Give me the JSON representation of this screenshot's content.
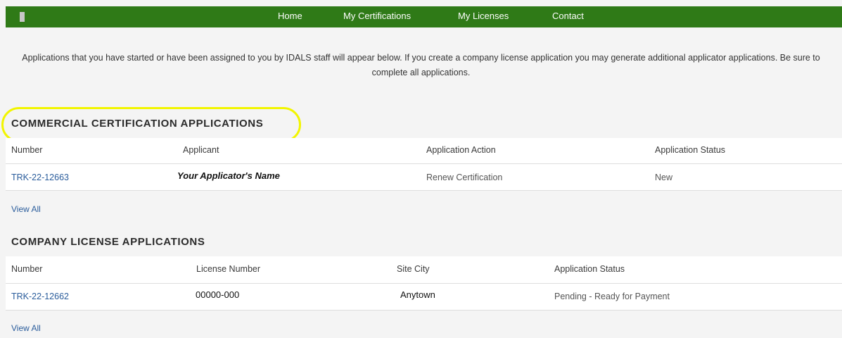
{
  "nav": {
    "items": [
      "Home",
      "My Certifications",
      "My Licenses",
      "Contact"
    ]
  },
  "intro": {
    "text": "Applications that you have started or have been assigned to you by IDALS staff will appear below.  If you create a company license application you may generate additional applicator applications.  Be sure to complete all applications."
  },
  "commercial": {
    "title": "COMMERCIAL CERTIFICATION APPLICATIONS",
    "columns": [
      "Number",
      "Applicant",
      "Application Action",
      "Application Status"
    ],
    "rows": [
      {
        "number": "TRK-22-12663",
        "applicant": "Your Applicator's Name",
        "action": "Renew Certification",
        "status": "New"
      }
    ],
    "view_all": "View All"
  },
  "company": {
    "title": "COMPANY LICENSE APPLICATIONS",
    "columns": [
      "Number",
      "License Number",
      "Site City",
      "Application Status"
    ],
    "rows": [
      {
        "number": "TRK-22-12662",
        "license_number": "00000-000",
        "site_city": "Anytown",
        "status": "Pending - Ready for Payment"
      }
    ],
    "view_all": "View All"
  },
  "colors": {
    "nav_bg": "#2f7a17",
    "link": "#2a5c9b",
    "highlight": "#f2f500"
  }
}
